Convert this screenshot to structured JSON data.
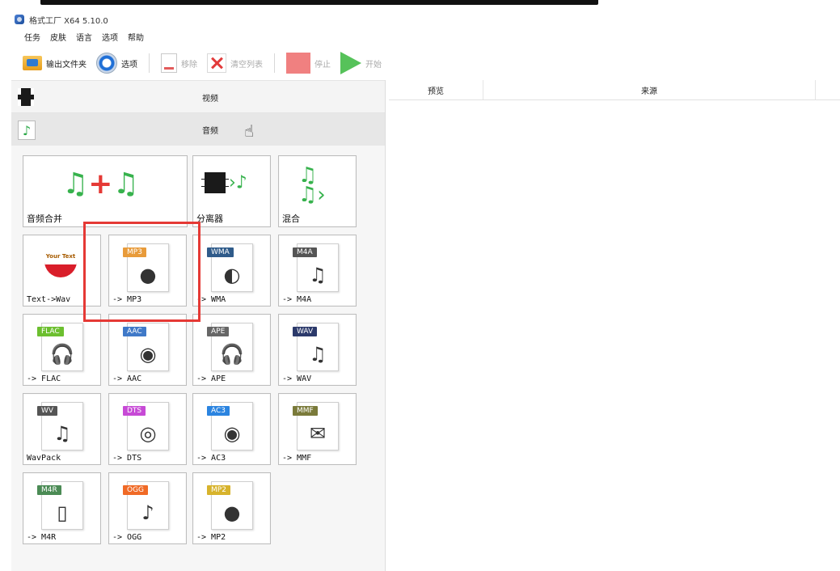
{
  "window": {
    "title": "格式工厂 X64 5.10.0"
  },
  "menu": [
    "任务",
    "皮肤",
    "语言",
    "选项",
    "帮助"
  ],
  "toolbar": {
    "output_folder": "输出文件夹",
    "options": "选项",
    "remove": "移除",
    "clear_list": "清空列表",
    "stop": "停止",
    "start": "开始"
  },
  "categories": {
    "video": "视频",
    "audio": "音频"
  },
  "audio_tools": [
    {
      "label": "音频合并",
      "icon": "audio-merge-icon"
    },
    {
      "label": "分离器",
      "icon": "splitter-icon"
    },
    {
      "label": "混合",
      "icon": "mix-icon"
    },
    {
      "label": "Text->Wav",
      "icon": "text-to-speech-icon",
      "badge": "Your Text"
    },
    {
      "label": "-> MP3",
      "icon": "mp3-file-icon",
      "badge": "MP3",
      "color": "#e89b3a"
    },
    {
      "label": "-> WMA",
      "icon": "wma-file-icon",
      "badge": "WMA",
      "color": "#2f5b8a"
    },
    {
      "label": "-> M4A",
      "icon": "m4a-file-icon",
      "badge": "M4A",
      "color": "#555555"
    },
    {
      "label": "-> FLAC",
      "icon": "flac-file-icon",
      "badge": "FLAC",
      "color": "#6cbf2f"
    },
    {
      "label": "-> AAC",
      "icon": "aac-file-icon",
      "badge": "AAC",
      "color": "#3f79c8"
    },
    {
      "label": "-> APE",
      "icon": "ape-file-icon",
      "badge": "APE",
      "color": "#666666"
    },
    {
      "label": "-> WAV",
      "icon": "wav-file-icon",
      "badge": "WAV",
      "color": "#2c3a6b"
    },
    {
      "label": "WavPack",
      "icon": "wavpack-file-icon",
      "badge": "WV",
      "color": "#555555"
    },
    {
      "label": "-> DTS",
      "icon": "dts-file-icon",
      "badge": "DTS",
      "color": "#c74ad6"
    },
    {
      "label": "-> AC3",
      "icon": "ac3-file-icon",
      "badge": "AC3",
      "color": "#2b84e0"
    },
    {
      "label": "-> MMF",
      "icon": "mmf-file-icon",
      "badge": "MMF",
      "color": "#7a7a3a"
    },
    {
      "label": "-> M4R",
      "icon": "m4r-file-icon",
      "badge": "M4R",
      "color": "#4b8b55"
    },
    {
      "label": "-> OGG",
      "icon": "ogg-file-icon",
      "badge": "OGG",
      "color": "#f06a26"
    },
    {
      "label": "-> MP2",
      "icon": "mp2-file-icon",
      "badge": "MP2",
      "color": "#d7b32c"
    }
  ],
  "table": {
    "columns": [
      "预览",
      "来源"
    ]
  }
}
